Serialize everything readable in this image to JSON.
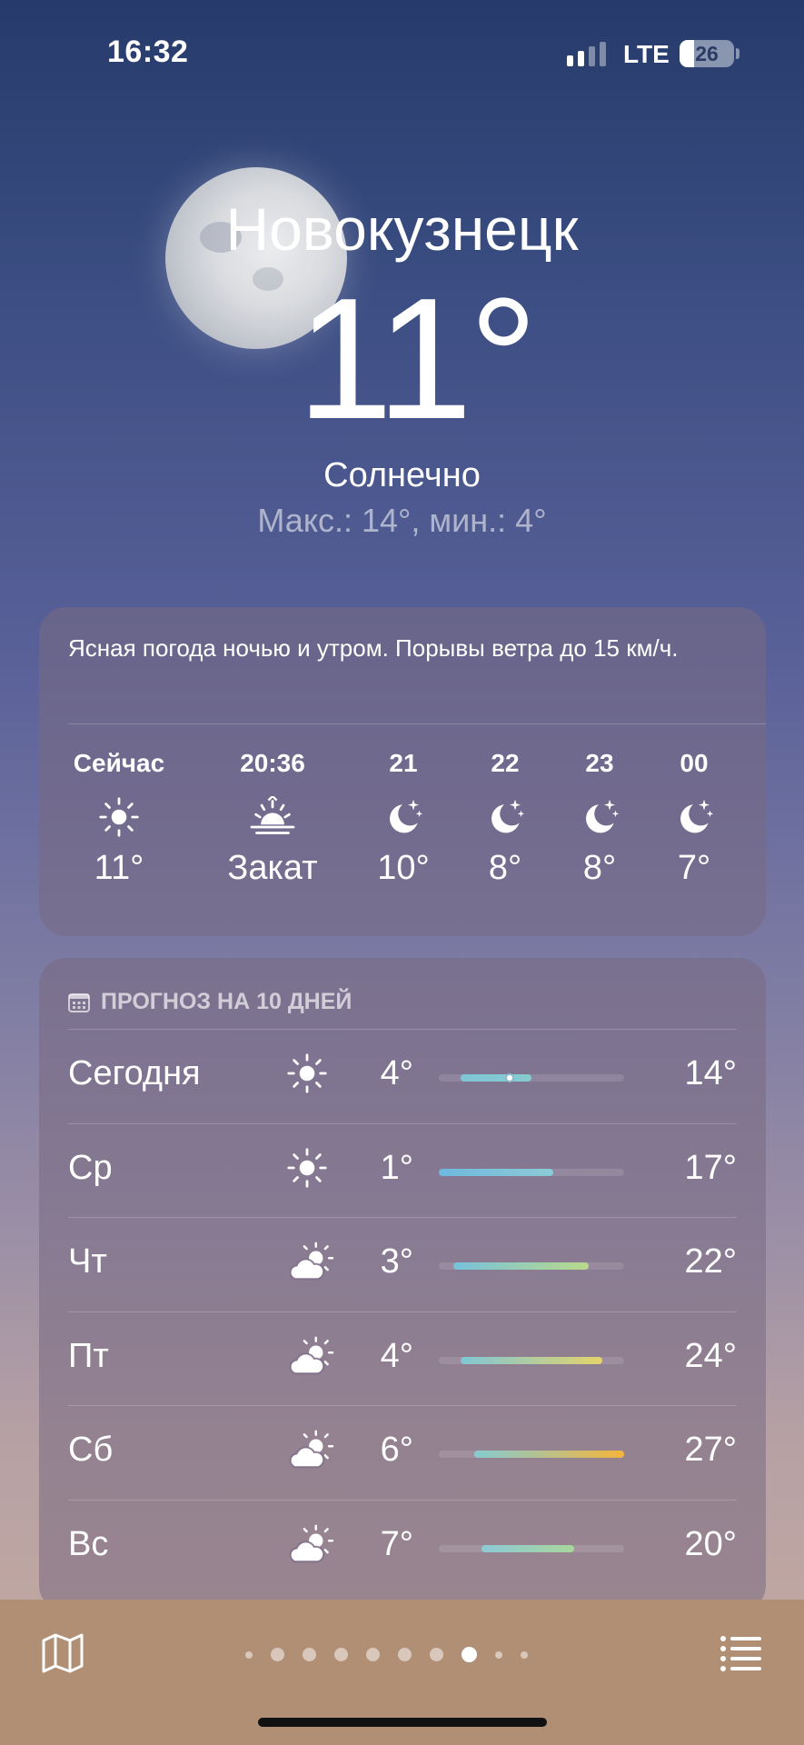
{
  "status_bar": {
    "time": "16:32",
    "network": "LTE",
    "battery_level": "26",
    "battery_fraction": 0.26,
    "signal_bars_active": 2,
    "signal_bars_total": 4
  },
  "location": {
    "city": "Новокузнецк",
    "temperature": "11°",
    "condition": "Солнечно",
    "hi_lo": "Макс.: 14°, мин.: 4°"
  },
  "hourly": {
    "summary": "Ясная погода ночью и утром. Порывы ветра до 15 км/ч.",
    "items": [
      {
        "label": "Сейчас",
        "icon": "sun-icon",
        "temp": "11°"
      },
      {
        "label": "20:36",
        "icon": "sunset-icon",
        "temp": "Закат"
      },
      {
        "label": "21",
        "icon": "moon-stars-icon",
        "temp": "10°"
      },
      {
        "label": "22",
        "icon": "moon-stars-icon",
        "temp": "8°"
      },
      {
        "label": "23",
        "icon": "moon-stars-icon",
        "temp": "8°"
      },
      {
        "label": "00",
        "icon": "moon-stars-icon",
        "temp": "7°"
      }
    ]
  },
  "daily": {
    "header": "ПРОГНОЗ НА 10 ДНЕЙ",
    "range": [
      1,
      27
    ],
    "days": [
      {
        "name": "Сегодня",
        "icon": "sun-icon",
        "low": "4°",
        "high": "14°",
        "low_val": 4,
        "high_val": 14,
        "current_val": 11,
        "colors": [
          "#7fc6d6",
          "#86cbd0"
        ]
      },
      {
        "name": "Ср",
        "icon": "sun-icon",
        "low": "1°",
        "high": "17°",
        "low_val": 1,
        "high_val": 17,
        "colors": [
          "#6fb8de",
          "#8ccad6"
        ]
      },
      {
        "name": "Чт",
        "icon": "partly-cloudy-icon",
        "low": "3°",
        "high": "22°",
        "low_val": 3,
        "high_val": 22,
        "colors": [
          "#76c2db",
          "#b9d98a"
        ]
      },
      {
        "name": "Пт",
        "icon": "partly-cloudy-icon",
        "low": "4°",
        "high": "24°",
        "low_val": 4,
        "high_val": 24,
        "colors": [
          "#7fc6d6",
          "#e4d36a"
        ]
      },
      {
        "name": "Сб",
        "icon": "partly-cloudy-icon",
        "low": "6°",
        "high": "27°",
        "low_val": 6,
        "high_val": 27,
        "colors": [
          "#86cbd0",
          "#f5b53c"
        ]
      },
      {
        "name": "Вс",
        "icon": "partly-cloudy-icon",
        "low": "7°",
        "high": "20°",
        "low_val": 7,
        "high_val": 20,
        "colors": [
          "#8ccad6",
          "#a9d59c"
        ]
      }
    ]
  },
  "bottom_bar": {
    "page_count": 10,
    "active_page": 8
  }
}
